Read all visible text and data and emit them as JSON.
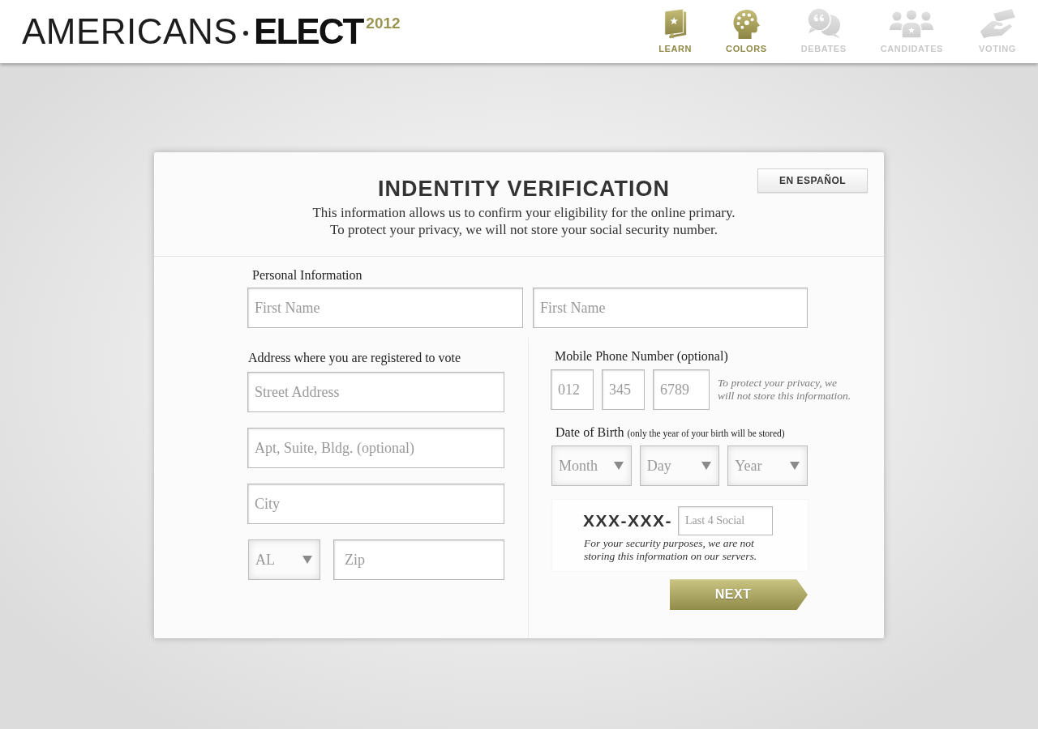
{
  "header": {
    "logo": {
      "word": "AMERICANS",
      "brand": "ELECT",
      "year": "2012"
    },
    "nav": [
      {
        "label": "LEARN",
        "active": true
      },
      {
        "label": "COLORS",
        "active": true
      },
      {
        "label": "DEBATES",
        "active": false
      },
      {
        "label": "CANDIDATES",
        "active": false
      },
      {
        "label": "VOTING",
        "active": false
      }
    ]
  },
  "card": {
    "language_button": "EN ESPAÑOL",
    "title": "INDENTITY VERIFICATION",
    "intro": "This information allows us to confirm your eligibility for the online primary.\nTo protect your privacy, we will not store your social security number."
  },
  "personal_information": {
    "label": "Personal Information",
    "fields": [
      {
        "placeholder": "First Name"
      },
      {
        "placeholder": "First Name"
      }
    ]
  },
  "address": {
    "label": "Address where you are registered to vote",
    "fields": [
      {
        "placeholder": "Street Address"
      },
      {
        "placeholder": "Apt, Suite, Bldg. (optional)"
      },
      {
        "placeholder": "City"
      }
    ],
    "state": {
      "value": "AL"
    },
    "zip": {
      "placeholder": "Zip"
    }
  },
  "mobile_phone": {
    "label": "Mobile Phone Number (optional)",
    "fields": [
      {
        "placeholder": "012"
      },
      {
        "placeholder": "345"
      },
      {
        "placeholder": "6789"
      }
    ],
    "note": "To protect your privacy, we\nwill not store this information."
  },
  "date_of_birth": {
    "label": "Date of Birth",
    "note": "(only the year of your birth will be stored)",
    "selects": [
      {
        "value": "Month"
      },
      {
        "value": "Day"
      },
      {
        "value": "Year"
      }
    ]
  },
  "social_security": {
    "prefix": "XXX-XXX-",
    "field": {
      "placeholder": "Last 4 Social"
    },
    "note": "For your security purposes, we are not\nstoring this information on our servers."
  },
  "next_button": {
    "label": "NEXT"
  }
}
